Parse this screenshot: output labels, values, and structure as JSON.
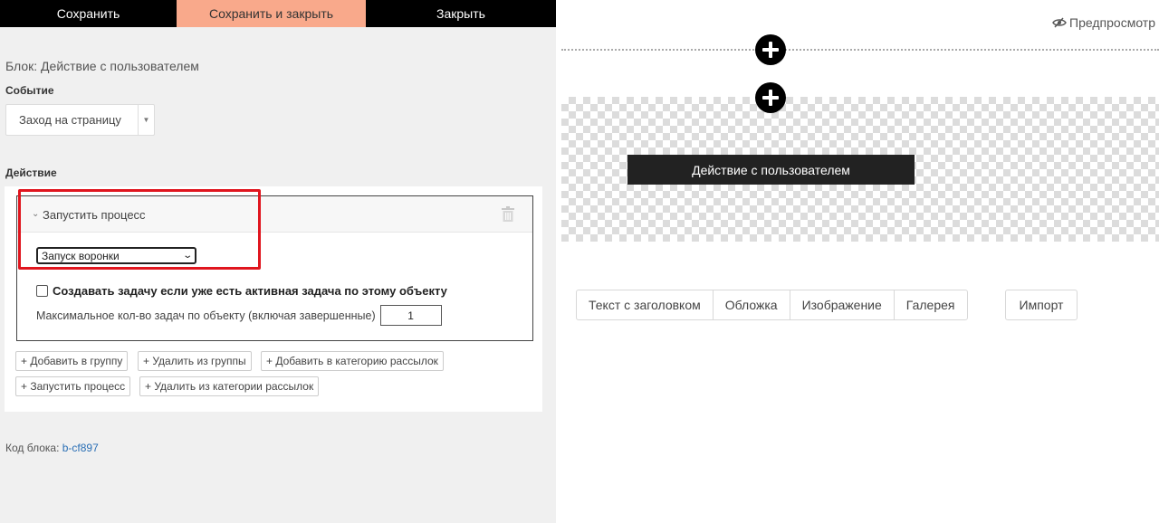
{
  "toolbar": {
    "save_label": "Сохранить",
    "save_close_label": "Сохранить и закрыть",
    "close_label": "Закрыть"
  },
  "colors": {
    "toolbar_bg": "#000000",
    "save_close_bg": "#f9a98b",
    "highlight": "#e0151e",
    "link": "#2a6fb5"
  },
  "panel": {
    "block_title": "Блок: Действие с пользователем",
    "event_label": "Событие",
    "event_value": "Заход на страницу",
    "action_label": "Действие",
    "process": {
      "title": "Запустить процесс",
      "funnel_value": "Запуск воронки",
      "checkbox_label": "Создавать задачу если уже есть активная задача по этому объекту",
      "checkbox_checked": false,
      "max_label": "Максимальное кол-во задач по объекту (включая завершенные)",
      "max_value": "1"
    },
    "action_buttons": [
      "+ Добавить в группу",
      "+ Удалить из группы",
      "+ Добавить в категорию рассылок",
      "+ Запустить процесс",
      "+ Удалить из категории рассылок"
    ],
    "code_label": "Код блока: ",
    "code_value": "b-cf897"
  },
  "canvas": {
    "preview_label": "Предпросмотр",
    "block_label": "Действие с пользователем",
    "templates": [
      "Текст с заголовком",
      "Обложка",
      "Изображение",
      "Галерея"
    ],
    "import_label": "Импорт"
  }
}
